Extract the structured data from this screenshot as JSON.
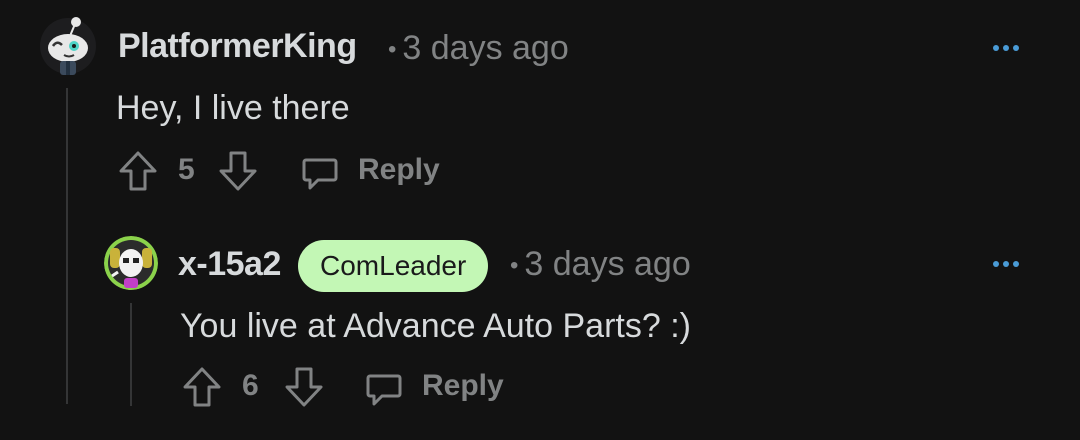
{
  "comments": [
    {
      "username": "PlatformerKing",
      "time": "3 days ago",
      "body": "Hey, I live there",
      "votes": "5",
      "reply_label": "Reply",
      "flair": ""
    },
    {
      "username": "x-15a2",
      "time": "3 days ago",
      "body": "You live at Advance Auto Parts? :)",
      "votes": "6",
      "reply_label": "Reply",
      "flair": "ComLeader"
    }
  ],
  "meta_separator": "•",
  "icons": {
    "upvote": "arrow-up-outline",
    "downvote": "arrow-down-outline",
    "reply": "speech-bubble",
    "more": "ellipsis-horizontal"
  },
  "colors": {
    "background": "#121212",
    "text": "#d7dadc",
    "muted": "#818384",
    "flair_bg": "#c3f7b5",
    "more_icon": "#4a9bd6"
  }
}
